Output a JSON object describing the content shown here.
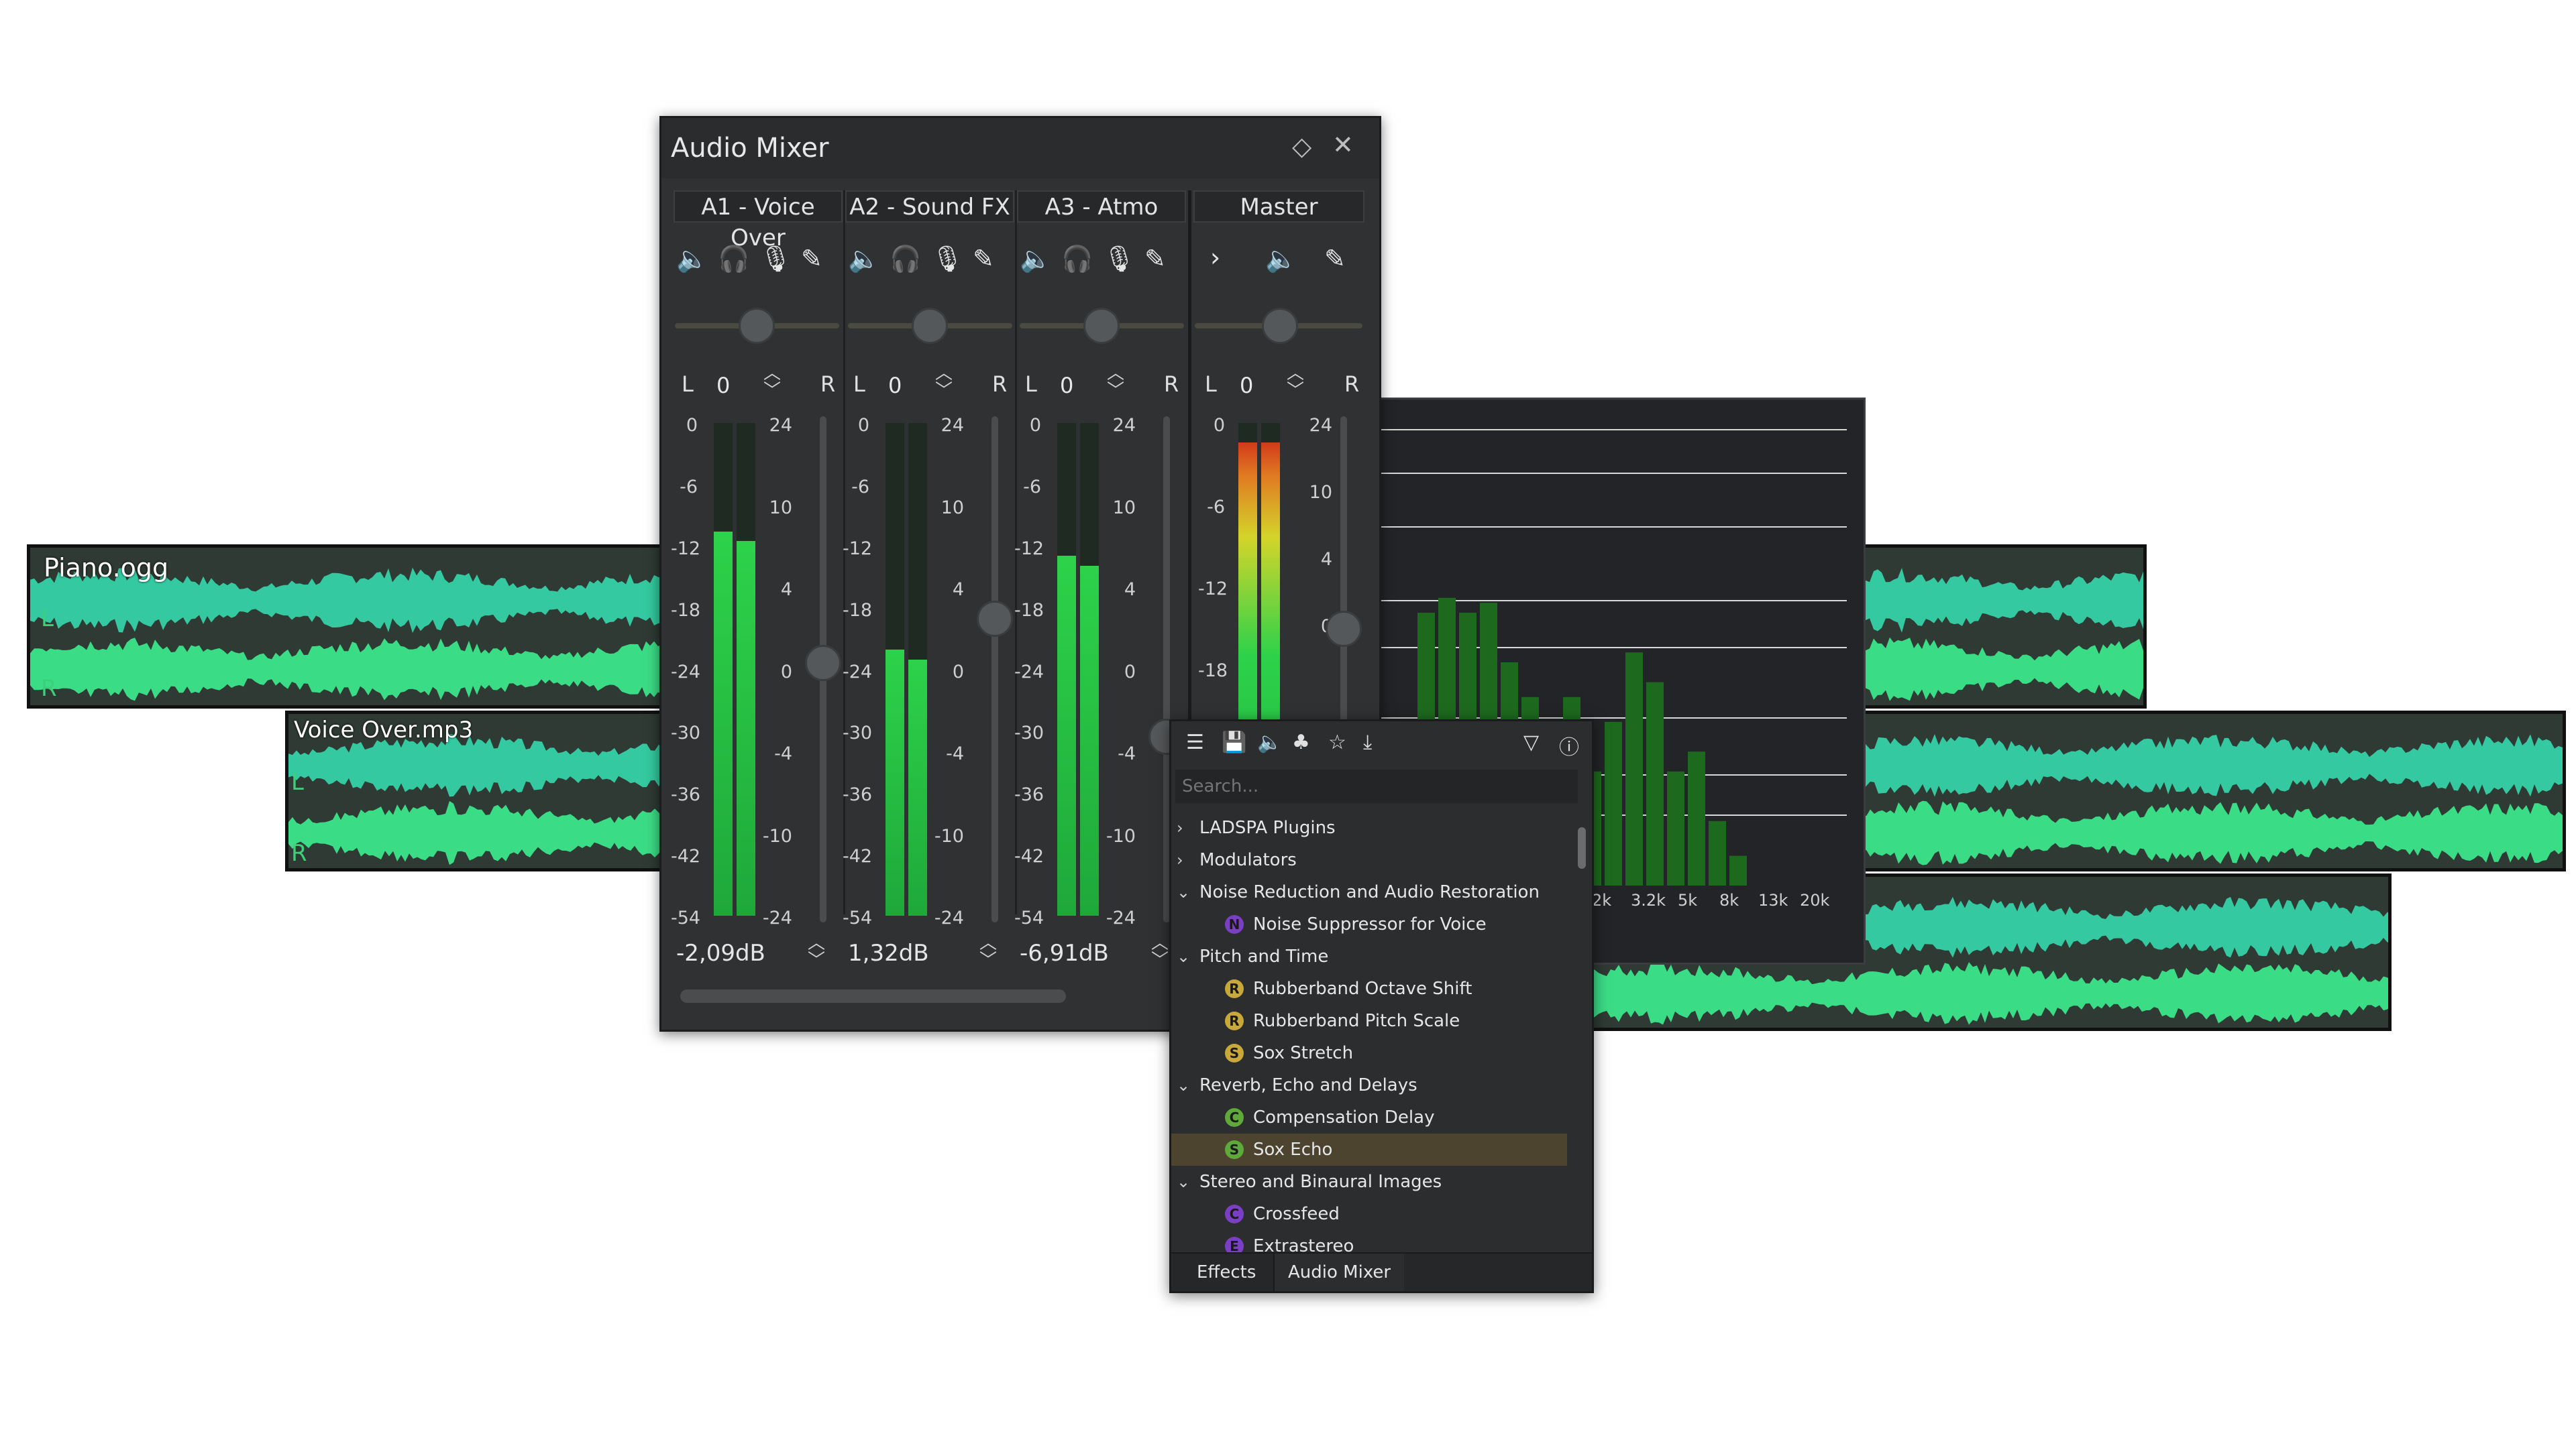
{
  "tracks": [
    {
      "title": "Piano.ogg",
      "left_label": "L",
      "right_label": "R"
    },
    {
      "title": "Voice Over.mp3",
      "left_label": "L",
      "right_label": "R"
    }
  ],
  "mixer": {
    "title": "Audio Mixer",
    "pin_icon": "diamond-icon",
    "close_icon": "close-icon",
    "channels": [
      {
        "name": "A1 - Voice Over",
        "pan": "0",
        "gain": "-2,09dB"
      },
      {
        "name": "A2 - Sound FX",
        "pan": "0",
        "gain": "1,32dB"
      },
      {
        "name": "A3 - Atmo",
        "pan": "0",
        "gain": "-6,91dB"
      }
    ],
    "master": {
      "name": "Master",
      "pan": "0"
    },
    "pan_left": "L",
    "pan_right": "R",
    "meter_scale": [
      "0",
      "-6",
      "-12",
      "-18",
      "-24",
      "-30",
      "-36",
      "-42",
      "-54"
    ],
    "fader_scale": [
      "24",
      "10",
      "4",
      "0",
      "-4",
      "-10",
      "-24"
    ],
    "master_meter_scale": [
      "0",
      "-6",
      "-12",
      "-18"
    ],
    "master_fader_scale": [
      "24",
      "10",
      "4",
      "0"
    ],
    "levels": [
      0.78,
      0.54,
      0.73,
      0.96
    ]
  },
  "spectrum": {
    "freq_labels": [
      "2k",
      "3.2k",
      "5k",
      "8k",
      "13k",
      "20k"
    ]
  },
  "effects": {
    "search_placeholder": "Search...",
    "items": [
      {
        "type": "group",
        "label": "LADSPA Plugins",
        "expanded": false
      },
      {
        "type": "group",
        "label": "Modulators",
        "expanded": false
      },
      {
        "type": "group",
        "label": "Noise Reduction and Audio Restoration",
        "expanded": true
      },
      {
        "type": "item",
        "letter": "N",
        "color": "#7b3fc4",
        "label": "Noise Suppressor for Voice"
      },
      {
        "type": "group",
        "label": "Pitch and Time",
        "expanded": true
      },
      {
        "type": "item",
        "letter": "R",
        "color": "#c9a83a",
        "label": "Rubberband Octave Shift"
      },
      {
        "type": "item",
        "letter": "R",
        "color": "#c9a83a",
        "label": "Rubberband Pitch Scale"
      },
      {
        "type": "item",
        "letter": "S",
        "color": "#c9a83a",
        "label": "Sox Stretch"
      },
      {
        "type": "group",
        "label": "Reverb, Echo and Delays",
        "expanded": true
      },
      {
        "type": "item",
        "letter": "C",
        "color": "#5fa83a",
        "label": "Compensation Delay"
      },
      {
        "type": "item",
        "letter": "S",
        "color": "#5fa83a",
        "label": "Sox Echo",
        "selected": true
      },
      {
        "type": "group",
        "label": "Stereo and Binaural Images",
        "expanded": true
      },
      {
        "type": "item",
        "letter": "C",
        "color": "#7b3fc4",
        "label": "Crossfeed"
      },
      {
        "type": "item",
        "letter": "E",
        "color": "#7b3fc4",
        "label": "Extrastereo"
      }
    ],
    "tabs": [
      "Effects",
      "Audio Mixer"
    ]
  }
}
